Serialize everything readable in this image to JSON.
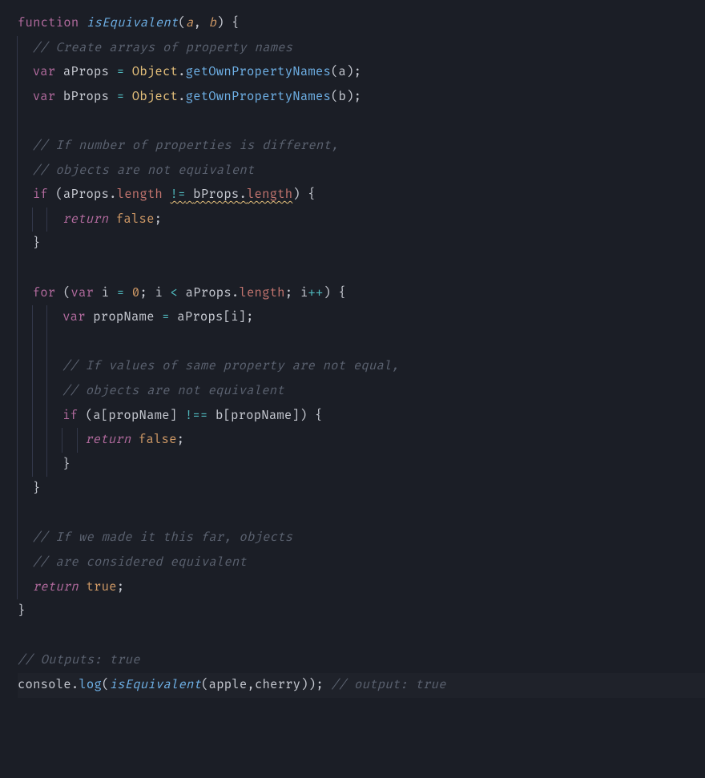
{
  "code": {
    "l1": {
      "kw": "function",
      "fn": "isEquivalent",
      "p1": "(",
      "a": "a",
      "c1": ", ",
      "b": "b",
      "p2": ") {"
    },
    "l2": {
      "cmt": "// Create arrays of property names"
    },
    "l3": {
      "kw": "var",
      "v": "aProps ",
      "eq": "= ",
      "obj": "Object",
      "dot": ".",
      "meth": "getOwnPropertyNames",
      "args": "(a);"
    },
    "l4": {
      "kw": "var",
      "v": "bProps ",
      "eq": "= ",
      "obj": "Object",
      "dot": ".",
      "meth": "getOwnPropertyNames",
      "args": "(b);"
    },
    "l6": {
      "cmt": "// If number of properties is different,"
    },
    "l7": {
      "cmt": "// objects are not equivalent"
    },
    "l8": {
      "kw": "if",
      "p1": " (",
      "v1": "aProps",
      "dot1": ".",
      "prop1": "length",
      "sp1": " ",
      "op": "!=",
      "sp2": " ",
      "v2": "bProps",
      "dot2": ".",
      "prop2": "length",
      "p2": ") {"
    },
    "l9": {
      "kw": "return",
      "sp": " ",
      "bool": "false",
      "semi": ";"
    },
    "l10": {
      "brace": "}"
    },
    "l12": {
      "kw": "for",
      "p1": " (",
      "kw2": "var",
      "v": " i ",
      "eq": "= ",
      "num": "0",
      "semi1": "; ",
      "v2": "i ",
      "lt": "< ",
      "v3": "aProps",
      "dot": ".",
      "prop": "length",
      "semi2": "; ",
      "v4": "i",
      "inc": "++",
      "p2": ") {"
    },
    "l13": {
      "kw": "var",
      "v": " propName ",
      "eq": "= ",
      "v2": "aProps[i];"
    },
    "l15": {
      "cmt": "// If values of same property are not equal,"
    },
    "l16": {
      "cmt": "// objects are not equivalent"
    },
    "l17": {
      "kw": "if",
      "p1": " (",
      "expr1": "a[propName] ",
      "op": "!==",
      "expr2": " b[propName]) {"
    },
    "l18": {
      "kw": "return",
      "sp": " ",
      "bool": "false",
      "semi": ";"
    },
    "l19": {
      "brace": "}"
    },
    "l20": {
      "brace": "}"
    },
    "l22": {
      "cmt": "// If we made it this far, objects"
    },
    "l23": {
      "cmt": "// are considered equivalent"
    },
    "l24": {
      "kw": "return",
      "sp": " ",
      "bool": "true",
      "semi": ";"
    },
    "l25": {
      "brace": "}"
    },
    "l27": {
      "cmt": "// Outputs: true"
    },
    "l28": {
      "cons": "console",
      "dot": ".",
      "meth": "log",
      "p1": "(",
      "fn": "isEquivalent",
      "args": "(apple,cherry)); ",
      "cmt": "// output: true"
    }
  }
}
